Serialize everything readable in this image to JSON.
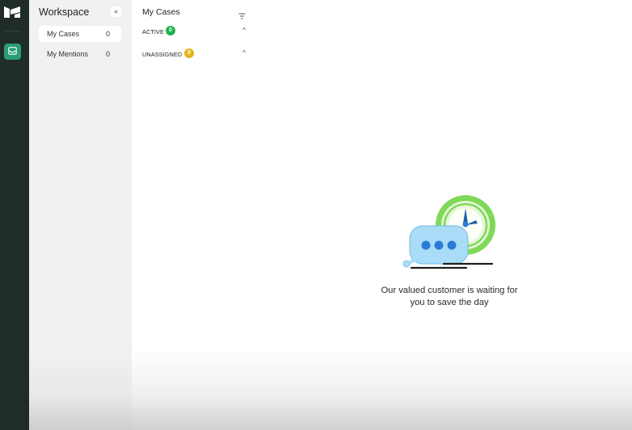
{
  "workspace": {
    "title": "Workspace",
    "collapse_glyph": "«",
    "items": [
      {
        "label": "My Cases",
        "count": "0"
      },
      {
        "label": "My Mentions",
        "count": "0"
      }
    ]
  },
  "cases": {
    "title": "My Cases",
    "sections": [
      {
        "name": "ACTIVE",
        "count": "0",
        "chevron": "^"
      },
      {
        "name": "UNASSIGNED",
        "count": "0",
        "chevron": "^"
      }
    ]
  },
  "empty_state": {
    "message_line1": "Our valued customer is waiting for",
    "message_line2": "you to save the day"
  },
  "colors": {
    "rail_bg": "#1f2c2a",
    "accent": "#2a9d72",
    "active_badge": "#22b14c",
    "unassigned_badge": "#e5b41a"
  },
  "icons": {
    "logo": "brand-logo-icon",
    "inbox": "inbox-icon",
    "filter": "filter-icon",
    "collapse": "double-chevron-left-icon",
    "empty_state": "chat-clock-illustration"
  }
}
